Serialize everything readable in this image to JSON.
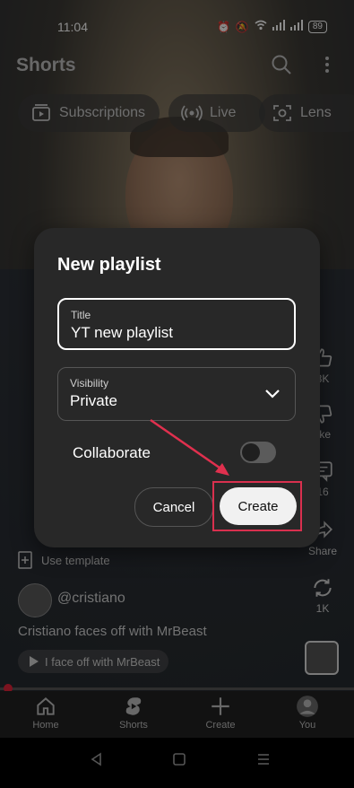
{
  "status_bar": {
    "time": "11:04",
    "battery": "89",
    "network": "Vo LTE"
  },
  "top_bar": {
    "title": "Shorts"
  },
  "chips": [
    {
      "label": "Subscriptions",
      "icon": "subscriptions-icon"
    },
    {
      "label": "Live",
      "icon": "live-icon"
    },
    {
      "label": "Lens",
      "icon": "lens-icon"
    }
  ],
  "side_actions": {
    "like_count": "8K",
    "dislike_label": "like",
    "comments_count": "16",
    "share_label": "Share",
    "remix_count": "1K"
  },
  "video": {
    "template_label": "Use template",
    "channel_handle": "@cristiano",
    "caption": "Cristiano faces off with MrBeast",
    "song_label": "I face off with MrBeast"
  },
  "nav": [
    {
      "label": "Home",
      "icon": "home-icon"
    },
    {
      "label": "Shorts",
      "icon": "shorts-icon"
    },
    {
      "label": "Create",
      "icon": "plus-icon"
    },
    {
      "label": "You",
      "icon": "avatar"
    }
  ],
  "dialog": {
    "title": "New playlist",
    "title_field": {
      "label": "Title",
      "value": "YT new playlist"
    },
    "visibility_field": {
      "label": "Visibility",
      "value": "Private"
    },
    "collaborate_label": "Collaborate",
    "cancel_label": "Cancel",
    "create_label": "Create"
  },
  "colors": {
    "accent_red": "#d9304e",
    "dialog_bg": "#282828"
  }
}
